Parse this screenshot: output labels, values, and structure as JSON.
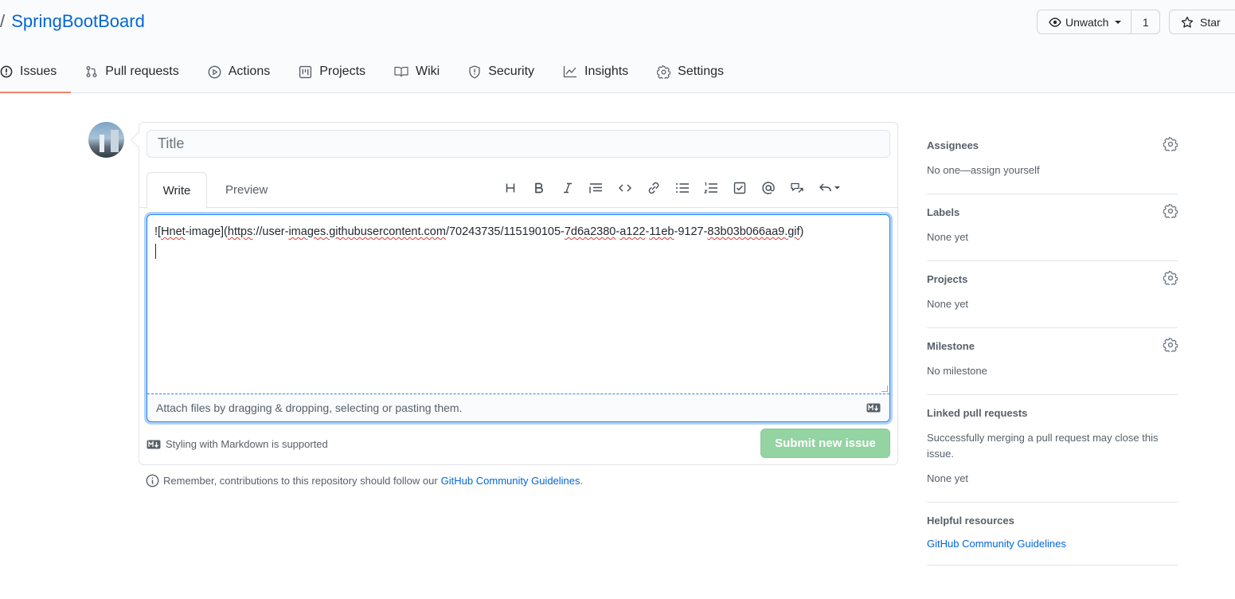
{
  "repo": {
    "separator": "/",
    "name": "SpringBootBoard"
  },
  "watch": {
    "label": "Unwatch",
    "count": "1"
  },
  "star": {
    "label": "Star"
  },
  "tabs": [
    {
      "label": "Issues",
      "icon": "issue-icon",
      "active": true
    },
    {
      "label": "Pull requests",
      "icon": "pull-request-icon"
    },
    {
      "label": "Actions",
      "icon": "play-icon"
    },
    {
      "label": "Projects",
      "icon": "project-icon"
    },
    {
      "label": "Wiki",
      "icon": "book-icon"
    },
    {
      "label": "Security",
      "icon": "shield-icon"
    },
    {
      "label": "Insights",
      "icon": "graph-icon"
    },
    {
      "label": "Settings",
      "icon": "gear-icon"
    }
  ],
  "form": {
    "title_placeholder": "Title",
    "title_value": "",
    "write_tab": "Write",
    "preview_tab": "Preview",
    "body_text_prefix": "![",
    "body_text_alt": "Hnet",
    "body_text_alt2": "-image](",
    "body_text_url_a": "https",
    "body_text_url_b": "://user-",
    "body_text_url_c": "images.githubusercontent.com",
    "body_text_url_d": "/70243735/115190105-",
    "body_text_url_e": "7d6a2380",
    "body_text_url_f": "-",
    "body_text_url_g": "a122",
    "body_text_url_h": "-",
    "body_text_url_i": "11eb",
    "body_text_url_j": "-9127-",
    "body_text_url_k": "83b03b066aa9.gif",
    "body_text_suffix": ")",
    "attach_text": "Attach files by dragging & dropping, selecting or pasting them.",
    "markdown_note": "Styling with Markdown is supported",
    "submit_label": "Submit new issue"
  },
  "remember": {
    "text": "Remember, contributions to this repository should follow our",
    "link": "GitHub Community Guidelines",
    "end": "."
  },
  "sidebar": {
    "assignees": {
      "title": "Assignees",
      "value": "No one—assign yourself"
    },
    "labels": {
      "title": "Labels",
      "value": "None yet"
    },
    "projects": {
      "title": "Projects",
      "value": "None yet"
    },
    "milestone": {
      "title": "Milestone",
      "value": "No milestone"
    },
    "linked": {
      "title": "Linked pull requests",
      "desc": "Successfully merging a pull request may close this issue.",
      "value": "None yet"
    },
    "helpful": {
      "title": "Helpful resources",
      "link": "GitHub Community Guidelines"
    }
  },
  "colors": {
    "link": "#0366d6",
    "tab_underline": "#f9826c",
    "submit_disabled": "#94d3a2",
    "focus": "#2188ff"
  }
}
